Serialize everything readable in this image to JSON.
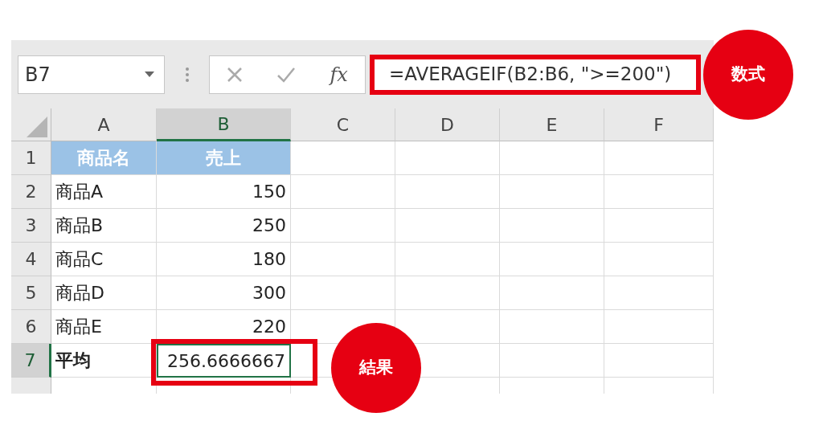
{
  "name_box": {
    "value": "B7"
  },
  "formula_bar": {
    "function_label": "fx",
    "formula": "=AVERAGEIF(B2:B6, \">=200\")"
  },
  "columns": [
    {
      "label": "A",
      "selected": false
    },
    {
      "label": "B",
      "selected": true
    },
    {
      "label": "C",
      "selected": false
    },
    {
      "label": "D",
      "selected": false
    },
    {
      "label": "E",
      "selected": false
    },
    {
      "label": "F",
      "selected": false
    }
  ],
  "rows": [
    {
      "label": "1",
      "selected": false,
      "cells": [
        {
          "text": "商品名",
          "kind": "header",
          "selected": false
        },
        {
          "text": "売上",
          "kind": "header",
          "selected": false
        }
      ]
    },
    {
      "label": "2",
      "selected": false,
      "cells": [
        {
          "text": "商品A",
          "kind": "text",
          "selected": false
        },
        {
          "text": "150",
          "kind": "number",
          "selected": false
        }
      ]
    },
    {
      "label": "3",
      "selected": false,
      "cells": [
        {
          "text": "商品B",
          "kind": "text",
          "selected": false
        },
        {
          "text": "250",
          "kind": "number",
          "selected": false
        }
      ]
    },
    {
      "label": "4",
      "selected": false,
      "cells": [
        {
          "text": "商品C",
          "kind": "text",
          "selected": false
        },
        {
          "text": "180",
          "kind": "number",
          "selected": false
        }
      ]
    },
    {
      "label": "5",
      "selected": false,
      "cells": [
        {
          "text": "商品D",
          "kind": "text",
          "selected": false
        },
        {
          "text": "300",
          "kind": "number",
          "selected": false
        }
      ]
    },
    {
      "label": "6",
      "selected": false,
      "cells": [
        {
          "text": "商品E",
          "kind": "text",
          "selected": false
        },
        {
          "text": "220",
          "kind": "number",
          "selected": false
        }
      ]
    },
    {
      "label": "7",
      "selected": true,
      "cells": [
        {
          "text": "平均",
          "kind": "label",
          "selected": false
        },
        {
          "text": "256.6666667",
          "kind": "number",
          "selected": true
        }
      ]
    }
  ],
  "annotations": [
    {
      "kind": "formula",
      "label": "数式"
    },
    {
      "kind": "result",
      "label": "結果"
    }
  ]
}
